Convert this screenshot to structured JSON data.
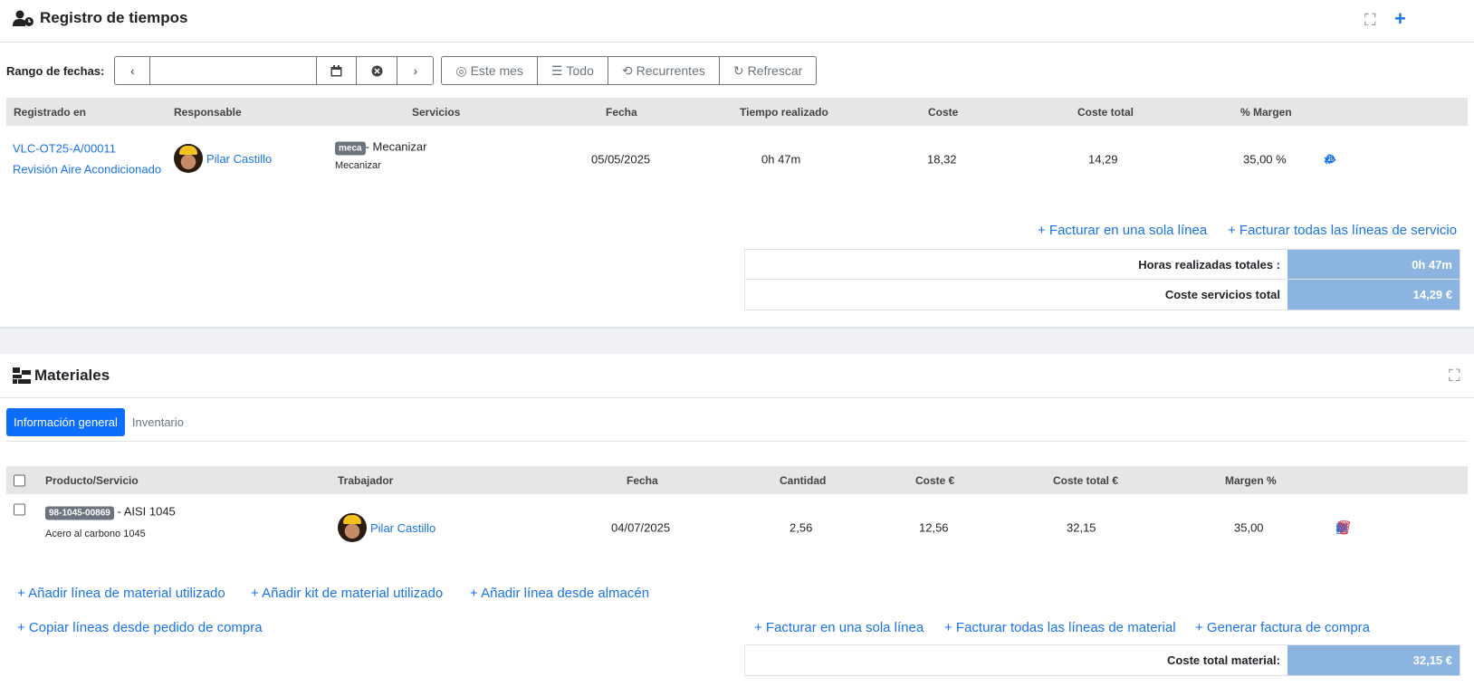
{
  "time_section": {
    "title": "Registro de tiempos",
    "range_label": "Rango de fechas:",
    "date_value": "",
    "filters": [
      "Este mes",
      "Todo",
      "Recurrentes",
      "Refrescar"
    ],
    "columns": [
      "Registrado en",
      "Responsable",
      "Servicios",
      "Fecha",
      "Tiempo realizado",
      "Coste",
      "Coste total",
      "% Margen"
    ],
    "row": {
      "registered_code": "VLC-OT25-A/00011",
      "registered_name": "Revisión Aire Acondicionado",
      "responsible": "Pilar Castillo",
      "service_badge": "meca",
      "service_name": "- Mecanizar",
      "service_sub": "Mecanizar",
      "date": "05/05/2025",
      "time": "0h 47m",
      "cost": "18,32",
      "total_cost": "14,29",
      "margin": "35,00 %"
    },
    "invoice_links": [
      "+ Facturar en una sola línea",
      "+ Facturar todas las líneas de servicio"
    ],
    "summary": [
      {
        "label": "Horas realizadas totales :",
        "value": "0h 47m"
      },
      {
        "label": "Coste servicios total",
        "value": "14,29 €"
      }
    ]
  },
  "materials_section": {
    "title": "Materiales",
    "tabs": [
      "Información general",
      "Inventario"
    ],
    "columns": [
      "Producto/Servicio",
      "Trabajador",
      "Fecha",
      "Cantidad",
      "Coste €",
      "Coste total €",
      "Margen %"
    ],
    "row": {
      "product_badge": "98-1045-00869",
      "product_name": "- AISI 1045",
      "product_sub": "Acero al carbono 1045",
      "worker": "Pilar Castillo",
      "date": "04/07/2025",
      "quantity": "2,56",
      "cost": "12,56",
      "total_cost": "32,15",
      "margin": "35,00"
    },
    "add_links": [
      "+ Añadir línea de material utilizado",
      "+ Añadir kit de material utilizado",
      "+ Añadir línea desde almacén",
      "+ Copiar líneas desde pedido de compra"
    ],
    "invoice_links": [
      "+ Facturar en una sola línea",
      "+ Facturar todas las líneas de material",
      "+ Generar factura de compra"
    ],
    "summary": {
      "label": "Coste total material:",
      "value": "32,15 €"
    }
  },
  "colors": {
    "accent": "#1a73e8",
    "tab_active": "#0d6efd",
    "summary_value_bg": "#8cb4e0"
  }
}
